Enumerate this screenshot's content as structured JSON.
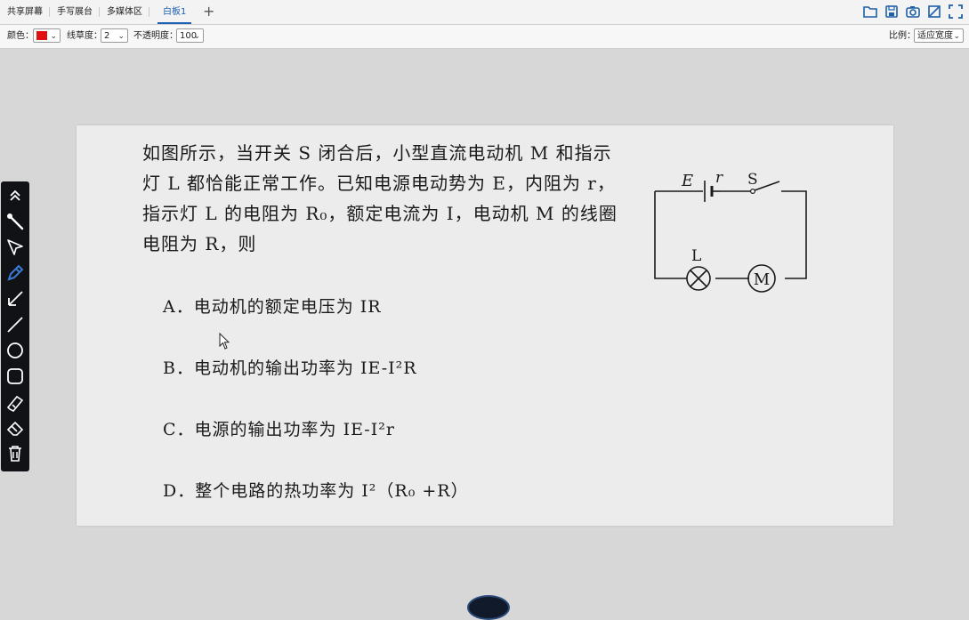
{
  "tabs": [
    {
      "label": "共享屏幕"
    },
    {
      "label": "手写展台"
    },
    {
      "label": "多媒体区"
    },
    {
      "label": "白板1",
      "active": true
    }
  ],
  "tab_add_label": "+",
  "toolbar": {
    "color_label": "颜色：",
    "color_value": "#e01010",
    "stroke_label": "线草度：",
    "stroke_value": "2",
    "opacity_label": "不透明度：",
    "opacity_value": "100",
    "scale_label": "比例：",
    "scale_value": "适应宽度"
  },
  "question": {
    "stem": [
      "如图所示，当开关 S 闭合后，小型直流电动机 M 和指示",
      "灯 L 都恰能正常工作。已知电源电动势为 E，内阻为 r，",
      "指示灯 L 的电阻为 R₀，额定电流为 I，电动机 M 的线圈",
      "电阻为 R，则"
    ],
    "options": [
      {
        "text": "A．电动机的额定电压为 IR"
      },
      {
        "text": "B．电动机的输出功率为 IE-I²R"
      },
      {
        "text": "C．电源的输出功率为 IE-I²r"
      },
      {
        "text": "D．整个电路的热功率为 I²（R₀ +R）"
      }
    ]
  },
  "circuit": {
    "label_E": "E",
    "label_r": "r",
    "label_S": "S",
    "label_L": "L",
    "label_M": "M"
  },
  "colors": {
    "accent": "#1a5fb4",
    "pen": "#e01010",
    "active_tool": "#3a7bd5"
  }
}
